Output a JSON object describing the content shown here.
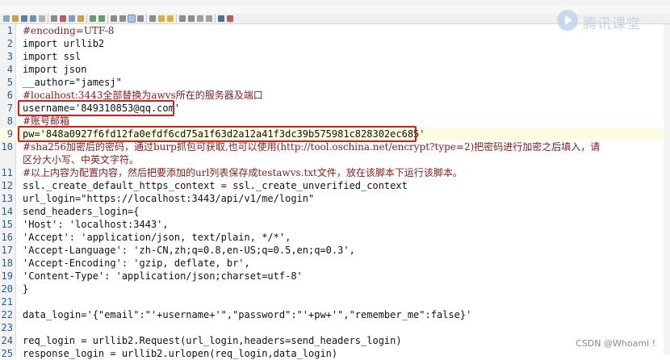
{
  "overlay": {
    "logo_text": "腾讯课堂",
    "watermark": "CSDN @Whoami !"
  },
  "editor": {
    "lines": [
      {
        "n": "1",
        "t": "#encoding=UTF-8",
        "k": "comment"
      },
      {
        "n": "2",
        "t": "import urllib2",
        "k": "plain"
      },
      {
        "n": "3",
        "t": "import ssl",
        "k": "plain"
      },
      {
        "n": "4",
        "t": "import json",
        "k": "plain"
      },
      {
        "n": "5",
        "t": "__author=\"jamesj\"",
        "k": "plain"
      },
      {
        "n": "6",
        "t": "#localhost:3443全部替换为awvs所在的服务器及端口",
        "k": "comment"
      },
      {
        "n": "7",
        "t": "username='849310853@qq.com'",
        "k": "plain"
      },
      {
        "n": "8",
        "t": "#账号邮箱",
        "k": "comment"
      },
      {
        "n": "9",
        "t": "pw='848a0927f6fd12fa0efdf6cd75a1f63d2a12a41f3dc39b575981c828302ec685'",
        "k": "plain"
      },
      {
        "n": "10",
        "t": "#sha256加密后的密码，通过burp抓包可获取,也可以使用(http://tool.oschina.net/encrypt?type=2)把密码进行加密之后填入，请",
        "k": "comment"
      },
      {
        "n": "",
        "t": "区分大小写、中英文字符。",
        "k": "comment"
      },
      {
        "n": "11",
        "t": "#以上内容为配置内容，然后把要添加的url列表保存成testawvs.txt文件，放在该脚本下运行该脚本。",
        "k": "comment"
      },
      {
        "n": "12",
        "t": "ssl._create_default_https_context = ssl._create_unverified_context",
        "k": "plain"
      },
      {
        "n": "13",
        "t": "url_login=\"https://localhost:3443/api/v1/me/login\"",
        "k": "plain"
      },
      {
        "n": "14",
        "t": "send_headers_login={",
        "k": "plain"
      },
      {
        "n": "15",
        "t": "'Host': 'localhost:3443',",
        "k": "plain"
      },
      {
        "n": "16",
        "t": "'Accept': 'application/json, text/plain, */*',",
        "k": "plain"
      },
      {
        "n": "17",
        "t": "'Accept-Language': 'zh-CN,zh;q=0.8,en-US;q=0.5,en;q=0.3',",
        "k": "plain"
      },
      {
        "n": "18",
        "t": "'Accept-Encoding': 'gzip, deflate, br',",
        "k": "plain"
      },
      {
        "n": "19",
        "t": "'Content-Type': 'application/json;charset=utf-8'",
        "k": "plain"
      },
      {
        "n": "20",
        "t": "}",
        "k": "plain"
      },
      {
        "n": "21",
        "t": "",
        "k": "plain"
      },
      {
        "n": "22",
        "t": "data_login='{\"email\":\"'+username+'\",\"password\":\"'+pw+'\",\"remember_me\":false}'",
        "k": "plain"
      },
      {
        "n": "23",
        "t": "",
        "k": "plain"
      },
      {
        "n": "24",
        "t": "req_login = urllib2.Request(url_login,headers=send_headers_login)",
        "k": "plain"
      },
      {
        "n": "25",
        "t": "response_login = urllib2.urlopen(req_login,data_login)",
        "k": "plain"
      }
    ]
  }
}
